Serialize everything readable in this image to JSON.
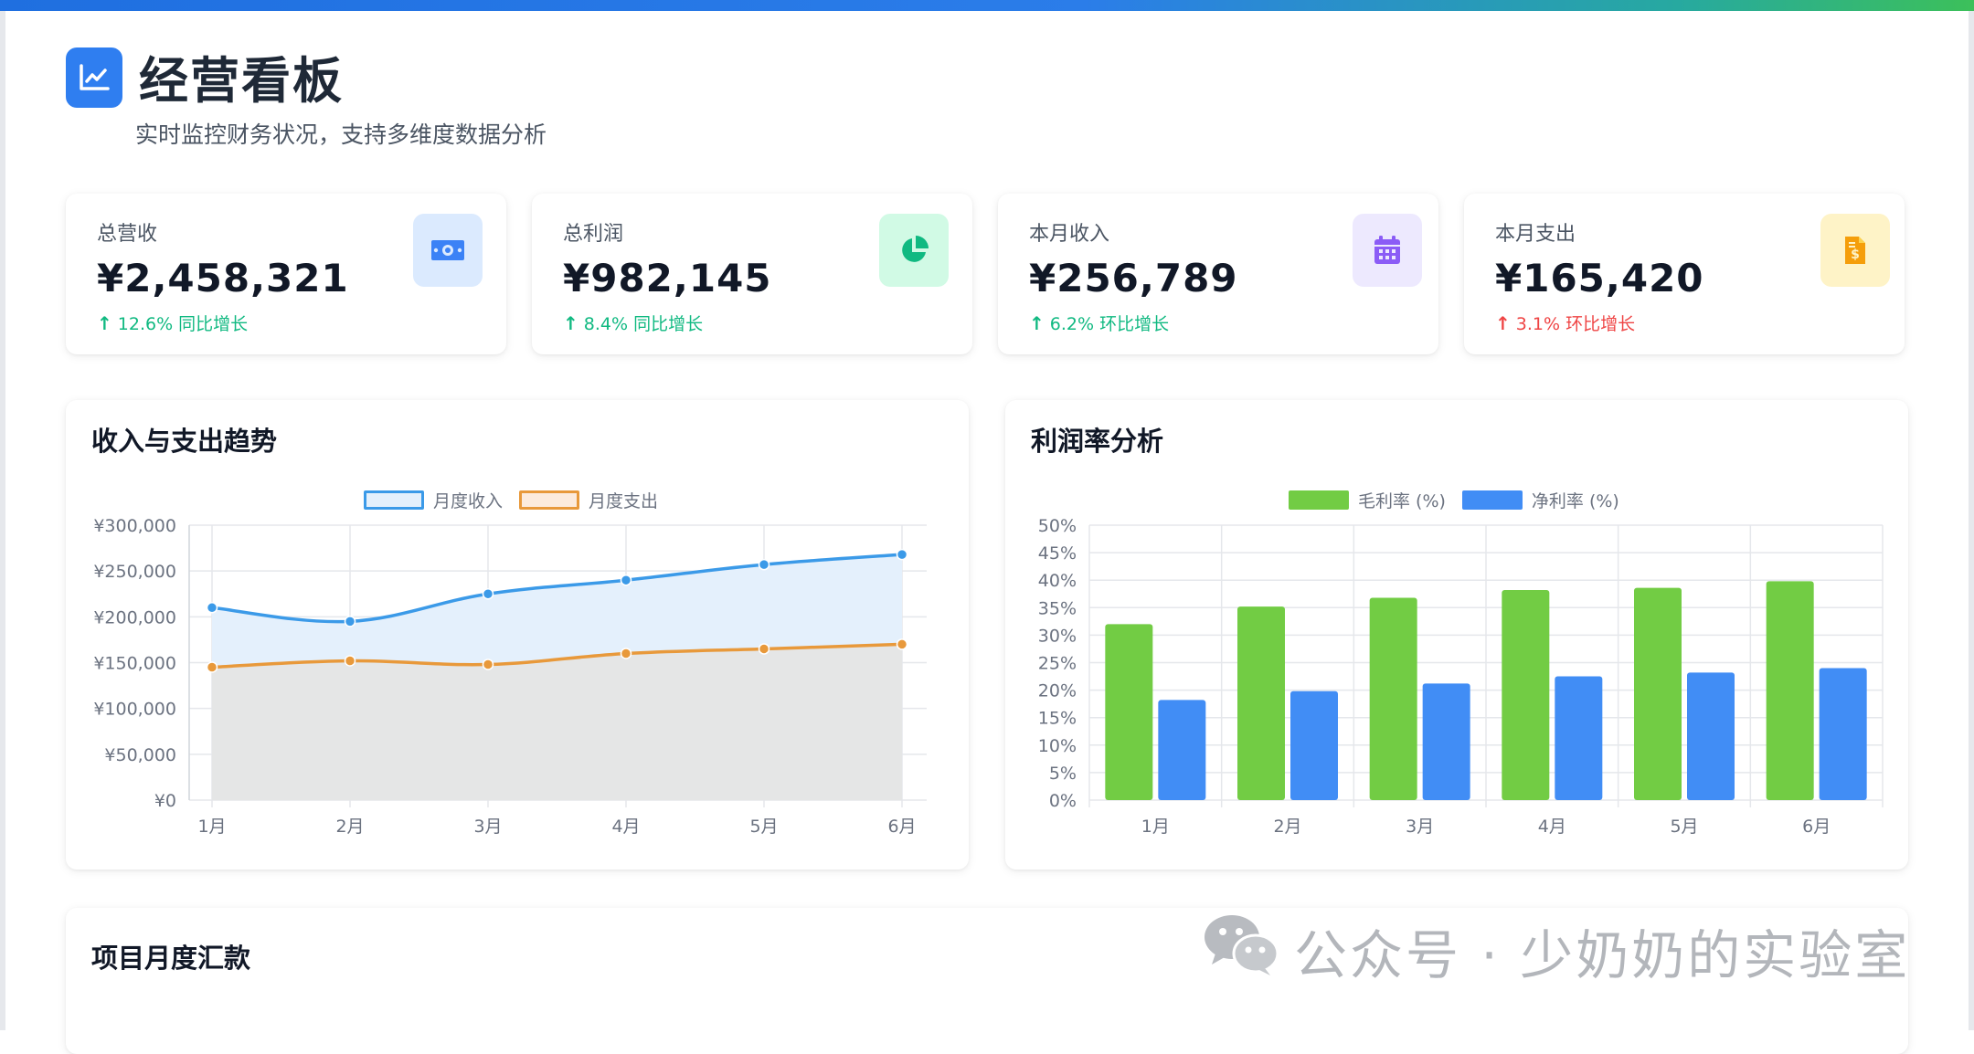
{
  "header": {
    "title": "经营看板",
    "subtitle": "实时监控财务状况，支持多维度数据分析",
    "icon": "chart-line-icon"
  },
  "stats": [
    {
      "label": "总营收",
      "value": "¥2,458,321",
      "trend": "12.6% 同比增长",
      "direction": "up",
      "trend_color": "#10b981",
      "icon": "money-bill-icon",
      "icon_bg": "#dbeafe",
      "icon_color": "#3b82f6"
    },
    {
      "label": "总利润",
      "value": "¥982,145",
      "trend": "8.4% 同比增长",
      "direction": "up",
      "trend_color": "#10b981",
      "icon": "pie-chart-icon",
      "icon_bg": "#d1fae5",
      "icon_color": "#10b981"
    },
    {
      "label": "本月收入",
      "value": "¥256,789",
      "trend": "6.2% 环比增长",
      "direction": "up",
      "trend_color": "#10b981",
      "icon": "calendar-icon",
      "icon_bg": "#ede9fe",
      "icon_color": "#8b5cf6"
    },
    {
      "label": "本月支出",
      "value": "¥165,420",
      "trend": "3.1% 环比增长",
      "direction": "up",
      "trend_color": "#ef4444",
      "icon": "invoice-dollar-icon",
      "icon_bg": "#fef3c7",
      "icon_color": "#f59e0b"
    }
  ],
  "trend_panel": {
    "title": "收入与支出趋势"
  },
  "profit_panel": {
    "title": "利润率分析"
  },
  "project_panel": {
    "title": "项目月度汇款"
  },
  "watermark": {
    "text": "公众号 · 少奶奶的实验室",
    "icon": "wechat-icon"
  },
  "chart_data": [
    {
      "type": "line",
      "title": "收入与支出趋势",
      "categories": [
        "1月",
        "2月",
        "3月",
        "4月",
        "5月",
        "6月"
      ],
      "series": [
        {
          "name": "月度收入",
          "values": [
            210000,
            195000,
            225000,
            240000,
            257000,
            268000
          ],
          "color": "#3b9ae8",
          "fill": "#e4f0fc"
        },
        {
          "name": "月度支出",
          "values": [
            145000,
            152000,
            148000,
            160000,
            165000,
            170000
          ],
          "color": "#e8993b",
          "fill": "#e5e6e6"
        }
      ],
      "y_ticks": [
        "¥0",
        "¥50,000",
        "¥100,000",
        "¥150,000",
        "¥200,000",
        "¥250,000",
        "¥300,000"
      ],
      "ylim": [
        0,
        300000
      ],
      "grid": true,
      "legend": "top-center"
    },
    {
      "type": "bar",
      "title": "利润率分析",
      "categories": [
        "1月",
        "2月",
        "3月",
        "4月",
        "5月",
        "6月"
      ],
      "series": [
        {
          "name": "毛利率 (%)",
          "values": [
            32,
            35.2,
            36.8,
            38.2,
            38.6,
            39.8
          ],
          "color": "#72cc44"
        },
        {
          "name": "净利率 (%)",
          "values": [
            18.2,
            19.8,
            21.2,
            22.5,
            23.2,
            24.0
          ],
          "color": "#418df5"
        }
      ],
      "y_ticks": [
        "0%",
        "5%",
        "10%",
        "15%",
        "20%",
        "25%",
        "30%",
        "35%",
        "40%",
        "45%",
        "50%"
      ],
      "ylim": [
        0,
        50
      ],
      "grid": true,
      "legend": "top-center"
    }
  ]
}
